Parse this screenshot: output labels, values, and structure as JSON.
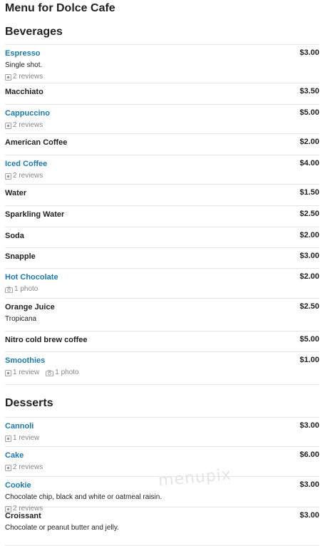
{
  "page_title": "Menu for Dolce Cafe",
  "watermark": "menupix",
  "sections": [
    {
      "title": "Beverages",
      "items": [
        {
          "name": "Espresso",
          "price": "$3.00",
          "desc": "Single shot.",
          "reviews": "2 reviews",
          "photos": "",
          "link": true
        },
        {
          "name": "Macchiato",
          "price": "$3.50",
          "desc": "",
          "reviews": "",
          "photos": "",
          "link": false
        },
        {
          "name": "Cappuccino",
          "price": "$5.00",
          "desc": "",
          "reviews": "2 reviews",
          "photos": "",
          "link": true
        },
        {
          "name": "American Coffee",
          "price": "$2.00",
          "desc": "",
          "reviews": "",
          "photos": "",
          "link": false
        },
        {
          "name": "Iced Coffee",
          "price": "$4.00",
          "desc": "",
          "reviews": "2 reviews",
          "photos": "",
          "link": true
        },
        {
          "name": "Water",
          "price": "$1.50",
          "desc": "",
          "reviews": "",
          "photos": "",
          "link": false
        },
        {
          "name": "Sparkling Water",
          "price": "$2.50",
          "desc": "",
          "reviews": "",
          "photos": "",
          "link": false
        },
        {
          "name": "Soda",
          "price": "$2.00",
          "desc": "",
          "reviews": "",
          "photos": "",
          "link": false
        },
        {
          "name": "Snapple",
          "price": "$3.00",
          "desc": "",
          "reviews": "",
          "photos": "",
          "link": false
        },
        {
          "name": "Hot Chocolate",
          "price": "$2.00",
          "desc": "",
          "reviews": "",
          "photos": "1 photo",
          "link": true
        },
        {
          "name": "Orange Juice",
          "price": "$2.50",
          "desc": "Tropicana",
          "reviews": "",
          "photos": "",
          "link": false
        },
        {
          "name": "Nitro cold brew coffee",
          "price": "$5.00",
          "desc": "",
          "reviews": "",
          "photos": "",
          "link": false
        },
        {
          "name": "Smoothies",
          "price": "$1.00",
          "desc": "",
          "reviews": "1 review",
          "photos": "1 photo",
          "link": true
        }
      ]
    },
    {
      "title": "Desserts",
      "items": [
        {
          "name": "Cannoli",
          "price": "$3.00",
          "desc": "",
          "reviews": "1 review",
          "photos": "",
          "link": true
        },
        {
          "name": "Cake",
          "price": "$6.00",
          "desc": "",
          "reviews": "2 reviews",
          "photos": "",
          "link": true
        },
        {
          "name": "Cookie",
          "price": "$3.00",
          "desc": "Chocolate chip, black and white or oatmeal raisin.",
          "reviews": "2 reviews",
          "photos": "",
          "link": true
        },
        {
          "name": "Croissant",
          "price": "$3.00",
          "desc": "Chocolate or peanut butter and jelly.",
          "reviews": "",
          "photos": "",
          "link": false
        }
      ]
    }
  ]
}
